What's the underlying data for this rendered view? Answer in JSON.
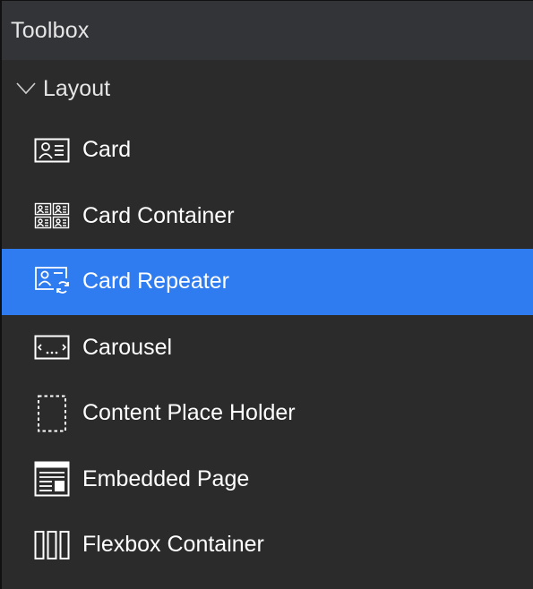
{
  "header": {
    "title": "Toolbox"
  },
  "section": {
    "label": "Layout",
    "expanded": true
  },
  "items": [
    {
      "label": "Card",
      "icon": "card-icon",
      "selected": false
    },
    {
      "label": "Card Container",
      "icon": "card-container-icon",
      "selected": false
    },
    {
      "label": "Card Repeater",
      "icon": "card-repeater-icon",
      "selected": true
    },
    {
      "label": "Carousel",
      "icon": "carousel-icon",
      "selected": false
    },
    {
      "label": "Content Place Holder",
      "icon": "content-placeholder-icon",
      "selected": false
    },
    {
      "label": "Embedded Page",
      "icon": "embedded-page-icon",
      "selected": false
    },
    {
      "label": "Flexbox Container",
      "icon": "flexbox-container-icon",
      "selected": false
    }
  ],
  "colors": {
    "background": "#2b2b2b",
    "header_background": "#333438",
    "selected": "#2f7bf0",
    "text": "#ffffff"
  }
}
